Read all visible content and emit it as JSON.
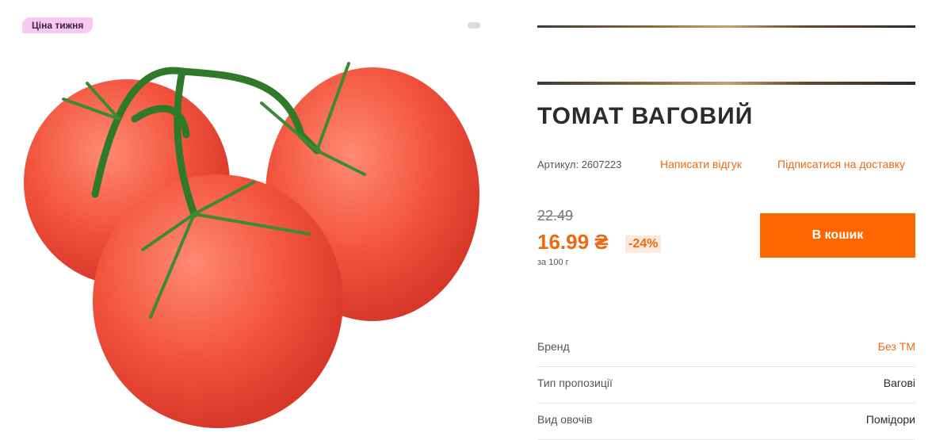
{
  "badge": "Ціна тижня",
  "product": {
    "title": "ТОМАТ ВАГОВИЙ",
    "sku_label": "Артикул: 2607223",
    "review_link": "Написати відгук",
    "subscribe_link": "Підписатися на доставку"
  },
  "price": {
    "old": "22.49",
    "current": "16.99 ₴",
    "discount": "-24%",
    "unit": "за 100 г"
  },
  "cart_button": "В кошик",
  "attributes": [
    {
      "label": "Бренд",
      "value": "Без ТМ"
    },
    {
      "label": "Тип пропозиції",
      "value": "Вагові"
    },
    {
      "label": "Вид овочів",
      "value": "Помідори"
    }
  ],
  "colors": {
    "accent": "#ff6600",
    "link": "#ec6a12",
    "badge": "#f7c8f1"
  }
}
